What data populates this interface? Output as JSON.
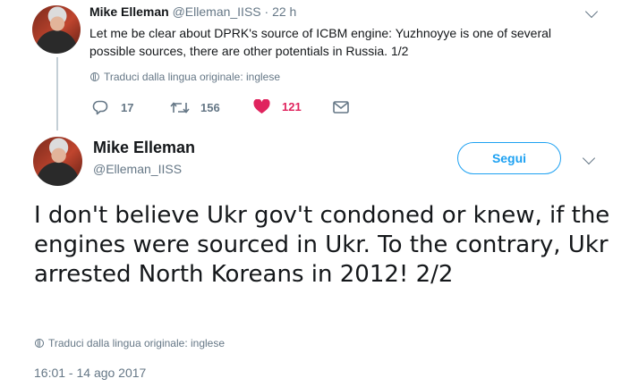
{
  "tweet1": {
    "name": "Mike Elleman",
    "handle": "@Elleman_IISS",
    "separator": "·",
    "time": "22 h",
    "text": "Let me be clear about DPRK's source of ICBM engine:  Yuzhnoyye is one of several possible sources, there are other potentials in Russia. 1/2",
    "translate": "Traduci dalla lingua originale: inglese",
    "actions": {
      "replies": "17",
      "retweets": "156",
      "likes": "121"
    }
  },
  "tweet2": {
    "name": "Mike Elleman",
    "handle": "@Elleman_IISS",
    "follow_label": "Segui",
    "text": "I don't believe Ukr gov't condoned or knew, if the engines were sourced in Ukr. To the contrary, Ukr arrested North Koreans in 2012! 2/2",
    "translate": "Traduci dalla lingua originale: inglese",
    "timestamp": "16:01 - 14 ago 2017"
  },
  "colors": {
    "accent": "#1da1f2",
    "like": "#e0245e",
    "muted": "#657786",
    "text": "#14171a"
  },
  "icons": [
    "reply-icon",
    "retweet-icon",
    "heart-icon",
    "message-icon",
    "globe-icon",
    "chevron-down-icon"
  ]
}
